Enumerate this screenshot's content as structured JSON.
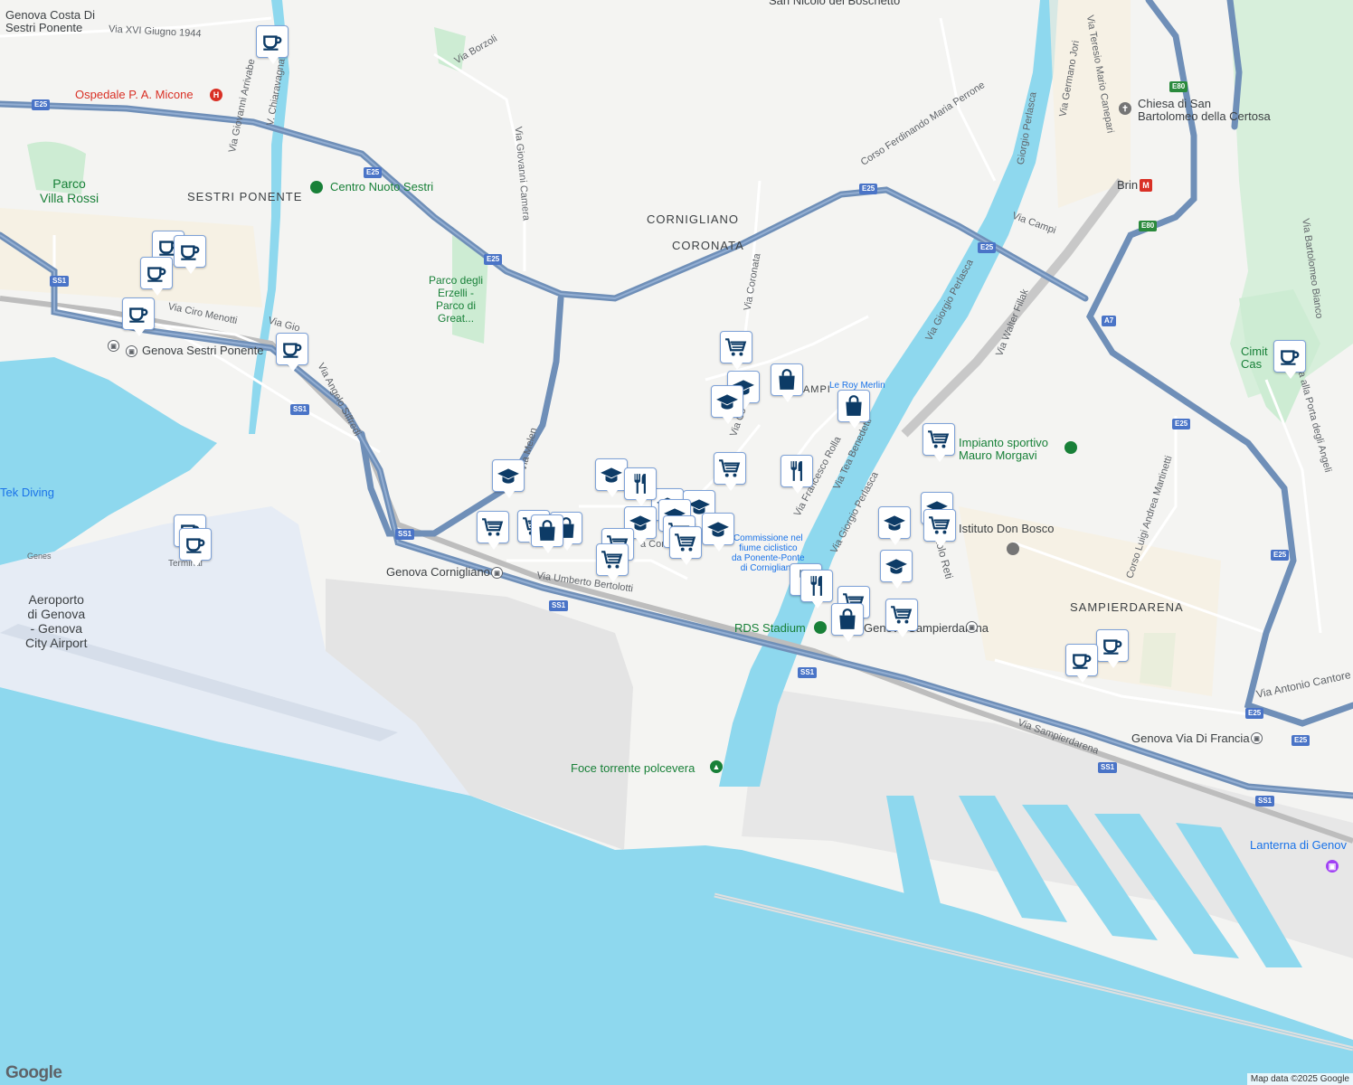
{
  "map": {
    "colors": {
      "land": "#f4f4f2",
      "water": "#8ed8ee",
      "highway": "#6f8fb8",
      "major_road": "#ffffff",
      "park": "#cdecd3",
      "airport": "#e6ecf5",
      "port": "#e3e3e3",
      "marker_icon": "#0d3b66",
      "marker_border": "#7ea2d8"
    },
    "attribution": "Map data ©2025 Google",
    "logo": "Google"
  },
  "districts": [
    {
      "id": "sestri-ponente",
      "text": "SESTRI PONENTE"
    },
    {
      "id": "cornigliano",
      "text": "CORNIGLIANO"
    },
    {
      "id": "coronata",
      "text": "CORONATA"
    },
    {
      "id": "sampierdarena",
      "text": "SAMPIERDARENA"
    },
    {
      "id": "campi",
      "text": "CAMPI"
    }
  ],
  "areas": [
    {
      "id": "airport",
      "text": "Aeroporto\ndi Genova\n- Genova\nCity Airport"
    },
    {
      "id": "parco-villa-rossi",
      "text": "Parco\nVilla Rossi"
    },
    {
      "id": "parco-erzelli",
      "text": "Parco degli\nErzelli -\nParco di\nGreat..."
    }
  ],
  "pois": [
    {
      "id": "ospedale",
      "text": "Ospedale P. A. Micone",
      "style": "red",
      "icon": "H",
      "icon_name": "hospital-icon"
    },
    {
      "id": "centro-nuoto",
      "text": "Centro Nuoto Sestri",
      "style": "green",
      "icon": "●",
      "icon_name": "leisure-icon"
    },
    {
      "id": "chiesa",
      "text": "Chiesa di San\nBartolomeo della Certosa",
      "style": "dark",
      "icon": "✝",
      "icon_name": "church-icon"
    },
    {
      "id": "brin",
      "text": "Brin",
      "style": "dark",
      "icon": "M",
      "icon_name": "metro-icon"
    },
    {
      "id": "impianto",
      "text": "Impianto sportivo\nMauro Morgavi",
      "style": "green",
      "icon": "●",
      "icon_name": "leisure-icon"
    },
    {
      "id": "istituto",
      "text": "Istituto Don Bosco",
      "style": "dark",
      "icon": "●",
      "icon_name": "school-icon"
    },
    {
      "id": "rds",
      "text": "RDS Stadium",
      "style": "green",
      "icon": "●",
      "icon_name": "leisure-icon"
    },
    {
      "id": "foce",
      "text": "Foce torrente polcevera",
      "style": "green",
      "icon": "▲",
      "icon_name": "tree-icon"
    },
    {
      "id": "lanterna",
      "text": "Lanterna di Genov",
      "style": "blue",
      "icon": "▣",
      "icon_name": "museum-icon"
    },
    {
      "id": "cimitero",
      "text": "Cimit   lla\nCas",
      "style": "green",
      "icon": "",
      "icon_name": ""
    },
    {
      "id": "tek-diving",
      "text": "Tek Diving",
      "style": "blue",
      "icon": "",
      "icon_name": ""
    },
    {
      "id": "genes",
      "text": "Genes",
      "style": "grey",
      "icon": "",
      "icon_name": ""
    },
    {
      "id": "terminal",
      "text": "Terminal",
      "style": "grey",
      "icon": "",
      "icon_name": ""
    },
    {
      "id": "le-roy-merlin",
      "text": "Le Roy Merlin",
      "style": "blue",
      "icon": "",
      "icon_name": ""
    },
    {
      "id": "commissione",
      "text": "Commissione nel\nfiume ciclistico\nda Ponente-Ponte\ndi Cornigliano",
      "style": "blue",
      "icon": "",
      "icon_name": ""
    },
    {
      "id": "san-nicolo",
      "text": "San Nicolò del Boschetto",
      "style": "dark",
      "icon": "",
      "icon_name": ""
    },
    {
      "id": "genova-costa",
      "text": "Genova Costa Di\nSestri Ponente",
      "style": "dark",
      "icon": "",
      "icon_name": ""
    }
  ],
  "stations": [
    {
      "id": "st-sestri",
      "text": "Genova Sestri Ponente"
    },
    {
      "id": "st-cornigliano",
      "text": "Genova Cornigliano"
    },
    {
      "id": "st-sampierdarena",
      "text": "Genova Sampierdarena"
    },
    {
      "id": "st-via-di-francia",
      "text": "Genova Via Di Francia"
    }
  ],
  "roads": [
    {
      "id": "via-xvi-giugno",
      "text": "Via XVI Giugno 1944"
    },
    {
      "id": "via-borzoli",
      "text": "Via Borzoli"
    },
    {
      "id": "via-giovanni-camera",
      "text": "Via Giovanni Camera"
    },
    {
      "id": "via-ciro-menotti",
      "text": "Via Ciro Menotti"
    },
    {
      "id": "via-angelo-siffredi",
      "text": "Via Angelo Siffredi"
    },
    {
      "id": "via-gio",
      "text": "Via Gio"
    },
    {
      "id": "via-melen",
      "text": "Via Melen"
    },
    {
      "id": "via-umberto-bertolotti",
      "text": "Via Umberto Bertolotti"
    },
    {
      "id": "via-corte",
      "text": "a Corte"
    },
    {
      "id": "via-coronata",
      "text": "Via Coronata"
    },
    {
      "id": "via-co",
      "text": "Via Co"
    },
    {
      "id": "via-francesco-rolla",
      "text": "Via Francesco Rolla"
    },
    {
      "id": "via-tea-benedetti",
      "text": "Via Tea Benedetti"
    },
    {
      "id": "via-giorgio-perlasca",
      "text": "Via Giorgio Perlasca"
    },
    {
      "id": "via-giorgio-perlasca-2",
      "text": "Via Giorgio Perlasca"
    },
    {
      "id": "giorgio-perlasca-top",
      "text": "Giorgio Perlasca"
    },
    {
      "id": "via-walter-fillak",
      "text": "Via Walter Fillak"
    },
    {
      "id": "via-campi",
      "text": "Via Campi"
    },
    {
      "id": "via-germano-jori",
      "text": "Via Germano Jori"
    },
    {
      "id": "via-teresio",
      "text": "Via Teresio Mario Canepari"
    },
    {
      "id": "corso-perrone",
      "text": "Corso Ferdinando Maria Perrone"
    },
    {
      "id": "corso-martinetti",
      "text": "Corso Luigi Andrea Martinetti"
    },
    {
      "id": "via-sampierdarena",
      "text": "Via Sampierdarena"
    },
    {
      "id": "via-antonio-cantore",
      "text": "Via Antonio Cantore"
    },
    {
      "id": "via-porta-angeli",
      "text": "Via alla Porta degli Angeli"
    },
    {
      "id": "via-bartolomeo-bianco",
      "text": "Via Bartolomeo Bianco"
    },
    {
      "id": "via-paolo-reti",
      "text": "aolo Reti"
    },
    {
      "id": "via-giovanni-arrivabene",
      "text": "Via Giovanni Arrivabe"
    },
    {
      "id": "via-chiaravagna",
      "text": "V. Chiaravagna"
    }
  ],
  "shields": [
    "E25",
    "E25",
    "E25",
    "E25",
    "E25",
    "E25",
    "E80",
    "E80",
    "SS1",
    "SS1",
    "SS1",
    "SS1",
    "SS1",
    "SS1",
    "SS1",
    "A7",
    "E25",
    "E25",
    "E25"
  ],
  "marker_types": {
    "coffee": "coffee-cup-icon",
    "cart": "shopping-cart-icon",
    "bag": "shopping-bag-icon",
    "school": "graduation-cap-icon",
    "food": "fork-knife-icon"
  },
  "markers": [
    {
      "type": "coffee"
    },
    {
      "type": "coffee"
    },
    {
      "type": "coffee"
    },
    {
      "type": "coffee"
    },
    {
      "type": "coffee"
    },
    {
      "type": "coffee"
    },
    {
      "type": "coffee"
    },
    {
      "type": "coffee"
    },
    {
      "type": "coffee"
    },
    {
      "type": "coffee"
    },
    {
      "type": "coffee"
    },
    {
      "type": "school"
    },
    {
      "type": "school"
    },
    {
      "type": "school"
    },
    {
      "type": "school"
    },
    {
      "type": "school"
    },
    {
      "type": "school"
    },
    {
      "type": "school"
    },
    {
      "type": "school"
    },
    {
      "type": "school"
    },
    {
      "type": "school"
    },
    {
      "type": "school"
    },
    {
      "type": "food"
    },
    {
      "type": "food"
    },
    {
      "type": "food"
    },
    {
      "type": "food"
    },
    {
      "type": "cart"
    },
    {
      "type": "cart"
    },
    {
      "type": "cart"
    },
    {
      "type": "cart"
    },
    {
      "type": "cart"
    },
    {
      "type": "cart"
    },
    {
      "type": "cart"
    },
    {
      "type": "cart"
    },
    {
      "type": "cart"
    },
    {
      "type": "cart"
    },
    {
      "type": "cart"
    },
    {
      "type": "cart"
    },
    {
      "type": "bag"
    },
    {
      "type": "bag"
    },
    {
      "type": "bag"
    },
    {
      "type": "bag"
    },
    {
      "type": "bag"
    }
  ]
}
